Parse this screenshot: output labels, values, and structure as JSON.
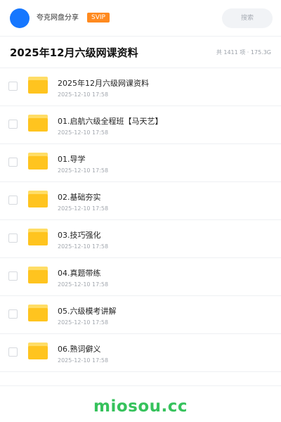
{
  "header": {
    "sharer_name": "夸克网盘分享",
    "badge": "SVIP",
    "search_placeholder": "搜索"
  },
  "page": {
    "title": "2025年12月六级网课资料",
    "stats": "共 1411 项 · 175.3G"
  },
  "files": [
    {
      "name": "2025年12月六级网课资料",
      "date": "2025-12-10 17:58"
    },
    {
      "name": "01.启航六级全程班【马天艺】",
      "date": "2025-12-10 17:58"
    },
    {
      "name": "01.导学",
      "date": "2025-12-10 17:58"
    },
    {
      "name": "02.基础夯实",
      "date": "2025-12-10 17:58"
    },
    {
      "name": "03.技巧强化",
      "date": "2025-12-10 17:58"
    },
    {
      "name": "04.真题带练",
      "date": "2025-12-10 17:58"
    },
    {
      "name": "05.六级模考讲解",
      "date": "2025-12-10 17:58"
    },
    {
      "name": "06.熟词僻义",
      "date": "2025-12-10 17:58"
    }
  ],
  "watermark": "miosou.cc",
  "colors": {
    "avatar": "#1677ff",
    "badge": "#ff8a1f",
    "folder": "#ffc41f",
    "watermark": "#36c25c"
  }
}
